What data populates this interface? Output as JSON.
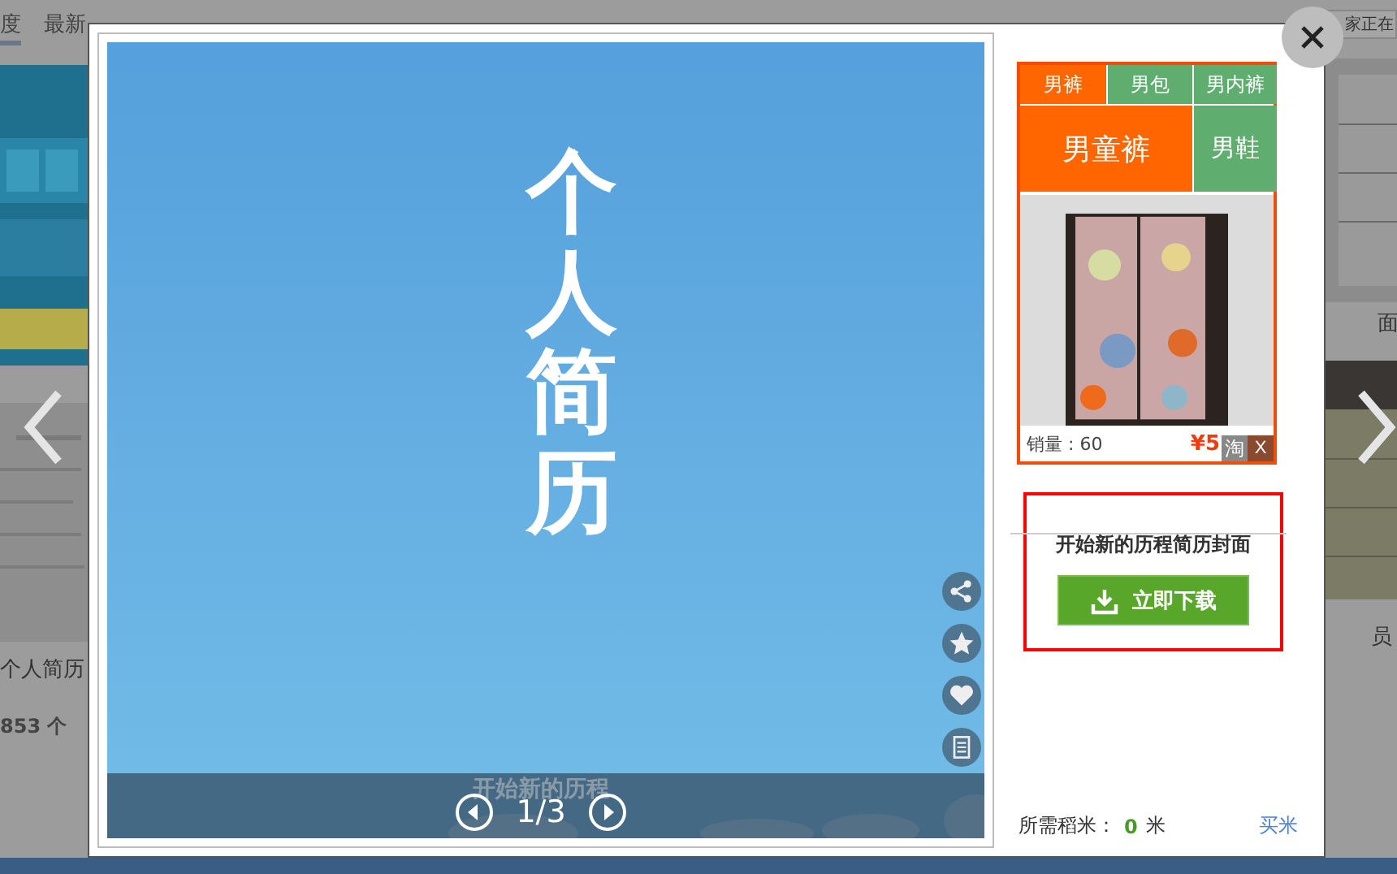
{
  "page_tabs": [
    {
      "label": "度",
      "selected": true
    },
    {
      "label": "最新",
      "selected": false
    }
  ],
  "search": {
    "placeholder": "家正在"
  },
  "left_column": {
    "title": "个人简历",
    "count": "853 个"
  },
  "right_column": {
    "title_1": "面",
    "title_2": "员"
  },
  "viewer": {
    "poster_title": "个人简历",
    "poster_subtitle": "开始新的历程",
    "page": "1/3",
    "actions": [
      {
        "kind": "share"
      },
      {
        "kind": "star"
      },
      {
        "kind": "like"
      },
      {
        "kind": "list"
      }
    ]
  },
  "ad": {
    "categories": [
      {
        "label": "男裤",
        "color": "#ff6600"
      },
      {
        "label": "男包",
        "color": "#5fae6f"
      },
      {
        "label": "男内裤",
        "color": "#5fae6f"
      },
      {
        "label": "男童裤",
        "color": "#ff6600"
      },
      {
        "label": "男鞋",
        "color": "#5fae6f"
      }
    ],
    "product": {
      "kind": "picture",
      "sales": "销量 : 60",
      "price": "¥5",
      "badge": "淘",
      "close": "X"
    }
  },
  "download": {
    "title": "开始新的历程简历封面",
    "button": "立即下载"
  },
  "cost": {
    "label": "所需稻米：",
    "amount": "0",
    "unit": "米",
    "link": "买米"
  }
}
